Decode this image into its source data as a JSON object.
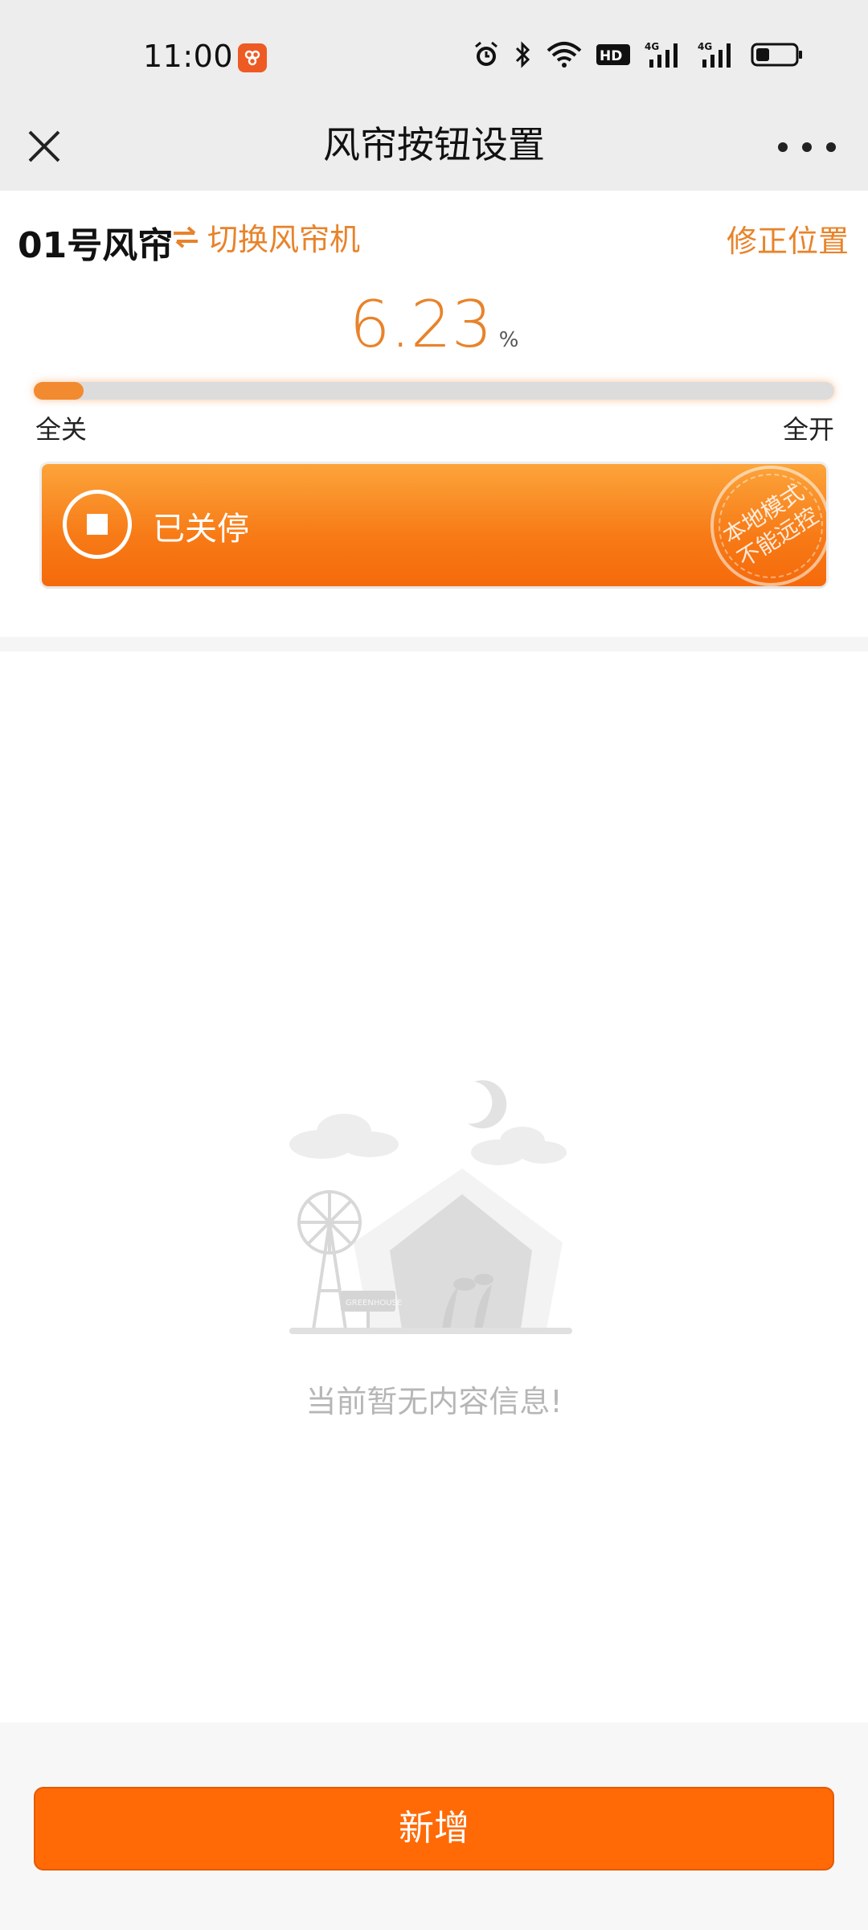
{
  "status_bar": {
    "time": "11:00",
    "icons": [
      "app-notification-icon",
      "alarm-icon",
      "bluetooth-icon",
      "wifi-icon",
      "hd-icon",
      "signal-4g-icon",
      "signal-4g-icon",
      "battery-icon"
    ]
  },
  "nav": {
    "title": "风帘按钮设置",
    "close_icon": "close-icon",
    "more_icon": "more-icon"
  },
  "curtain": {
    "name": "01号风帘",
    "switch_label": "切换风帘机",
    "fix_position_label": "修正位置",
    "percent": "6.23",
    "percent_unit": "%",
    "progress": 6.23,
    "range_min_label": "全关",
    "range_max_label": "全开",
    "state_label": "已关停",
    "stamp_line1": "本地模式",
    "stamp_line2": "不能远控"
  },
  "empty": {
    "message": "当前暂无内容信息!",
    "sign_text": "GREENHOUSE"
  },
  "footer": {
    "add_label": "新增"
  },
  "colors": {
    "accent": "#e8832a",
    "button": "#ff6a06"
  }
}
